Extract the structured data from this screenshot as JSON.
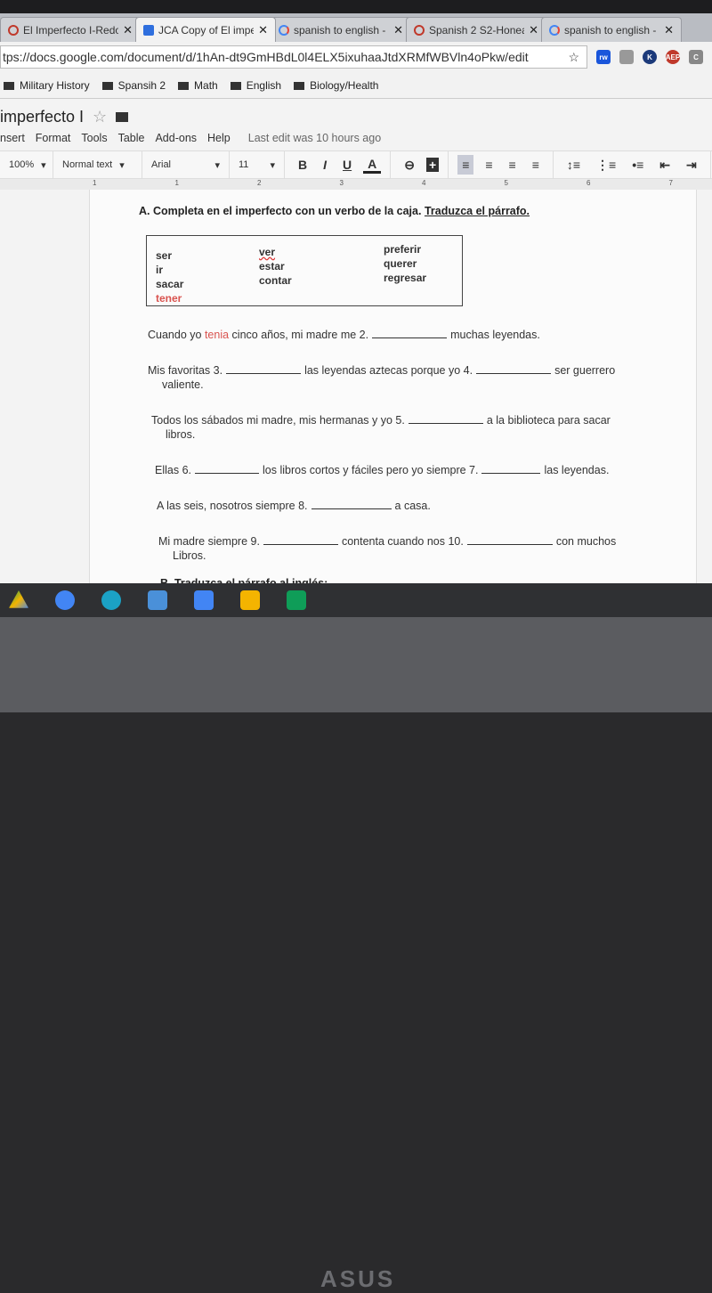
{
  "browser": {
    "tabs": [
      {
        "title": "El Imperfecto I-Redo",
        "icon": "red-ring-icon",
        "active": false
      },
      {
        "title": "JCA Copy of El impe",
        "icon": "google-docs-icon",
        "active": true
      },
      {
        "title": "spanish to english -",
        "icon": "google-icon",
        "active": false
      },
      {
        "title": "Spanish 2 S2-Honea",
        "icon": "red-ring-icon",
        "active": false
      },
      {
        "title": "spanish to english -",
        "icon": "google-icon",
        "active": false
      }
    ],
    "url": "tps://docs.google.com/document/d/1hAn-dt9GmHBdL0l4ELX5ixuhaaJtdXRMfWBVln4oPkw/edit",
    "extensions": [
      {
        "label": "rw",
        "color": "#1a56db"
      },
      {
        "label": "",
        "color": "#888"
      },
      {
        "label": "K",
        "color": "#1c3a7a"
      },
      {
        "label": "AEP",
        "color": "#c0392b"
      },
      {
        "label": "C",
        "color": "#888"
      }
    ],
    "bookmarks": [
      "Military History",
      "Spansih 2",
      "Math",
      "English",
      "Biology/Health"
    ]
  },
  "docs": {
    "title": "imperfecto I",
    "menu": [
      "nsert",
      "Format",
      "Tools",
      "Table",
      "Add-ons",
      "Help"
    ],
    "last_edit": "Last edit was 10 hours ago",
    "toolbar": {
      "zoom": "100%",
      "style": "Normal text",
      "font": "Arial",
      "size": "11"
    },
    "ruler": [
      "1",
      "1",
      "2",
      "3",
      "4",
      "5",
      "6",
      "7"
    ]
  },
  "document": {
    "heading": "A. Completa en el imperfecto con un verbo de la caja.",
    "heading_link": "Traduzca el párrafo.",
    "verbs": {
      "col1": [
        "ser",
        "ir",
        "sacar",
        "tener"
      ],
      "col2": [
        "ver",
        "estar",
        "contar"
      ],
      "col3": [
        "preferir",
        "querer",
        "regresar"
      ]
    },
    "q1": {
      "a": "Cuando yo",
      "b": "tenia",
      "c": "cinco años, mi madre me 2.",
      "d": "muchas leyendas."
    },
    "q2": {
      "a": "Mis favoritas 3.",
      "b": "las leyendas aztecas porque yo 4.",
      "c": "ser guerrero",
      "d": "valiente."
    },
    "q3": {
      "a": "Todos los sábados mi madre, mis hermanas y yo 5.",
      "b": "a la biblioteca para sacar",
      "c": "libros."
    },
    "q4": {
      "a": "Ellas 6.",
      "b": "los libros cortos y fáciles pero yo siempre 7.",
      "c": "las leyendas."
    },
    "q5": {
      "a": "A las seis, nosotros siempre 8.",
      "b": "a casa."
    },
    "q6": {
      "a": "Mi madre siempre 9.",
      "b": "contenta cuando nos 10.",
      "c": "con muchos",
      "d": "Libros."
    },
    "section_b": "B. Traduzca el párrafo al inglés:"
  },
  "colors": {
    "accent": "#1a73e8",
    "red_text": "#d9534f"
  },
  "watermark": "ASUS"
}
